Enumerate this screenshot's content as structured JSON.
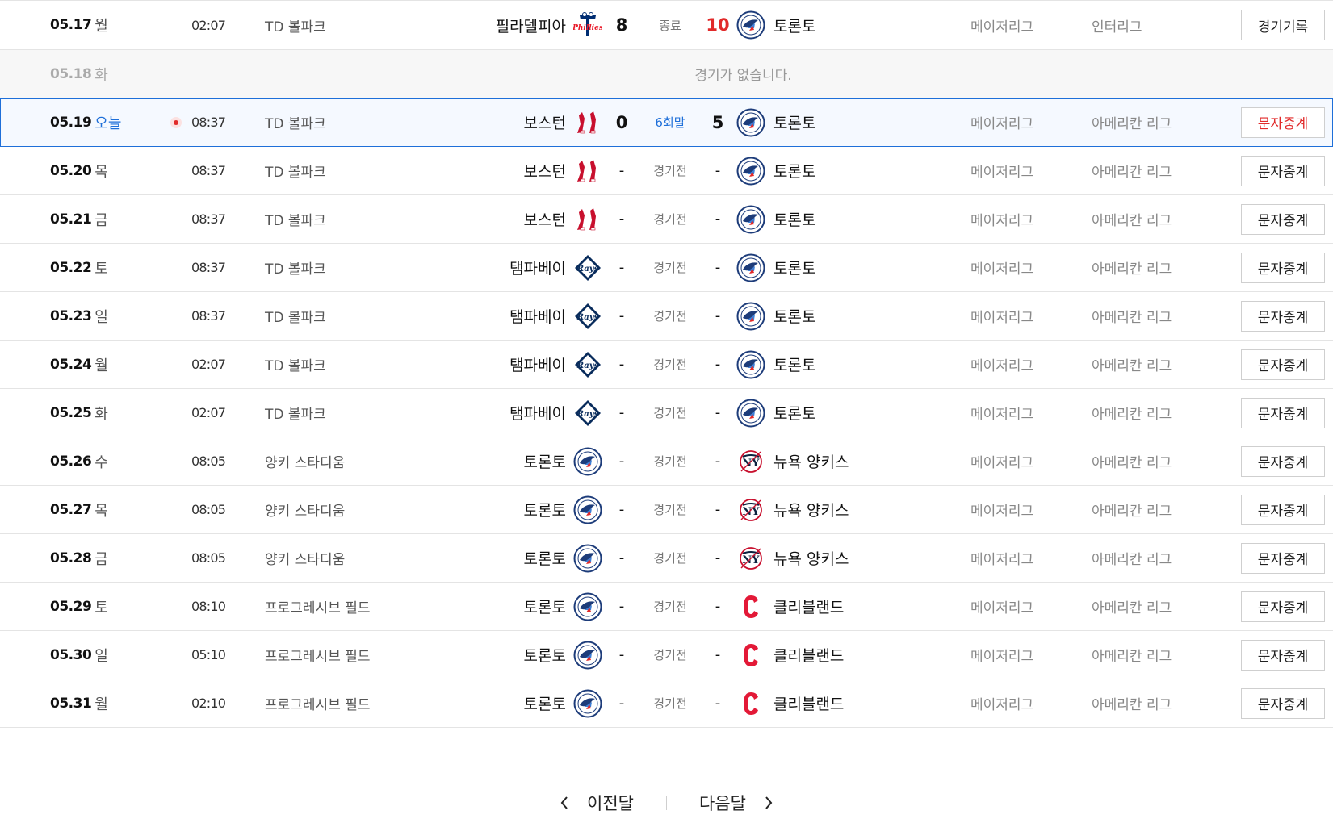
{
  "rows": [
    {
      "date": "05.17",
      "dow": "월",
      "time": "02:07",
      "stadium": "TD 볼파크",
      "away": "필라델피아",
      "away_logo": "phillies-logo",
      "away_score": "8",
      "status": "종료",
      "home_score": "10",
      "home": "토론토",
      "home_logo": "bluejays-logo",
      "league": "메이저리그",
      "division": "인터리그",
      "button": "경기기록",
      "type": "final",
      "winner": "home"
    },
    {
      "date": "05.18",
      "dow": "화",
      "type": "empty",
      "empty_text": "경기가 없습니다."
    },
    {
      "date": "05.19",
      "dow": "오늘",
      "time": "08:37",
      "stadium": "TD 볼파크",
      "away": "보스턴",
      "away_logo": "redsox-logo",
      "away_score": "0",
      "status": "6회말",
      "home_score": "5",
      "home": "토론토",
      "home_logo": "bluejays-logo",
      "league": "메이저리그",
      "division": "아메리칸 리그",
      "button": "문자중계",
      "type": "live"
    },
    {
      "date": "05.20",
      "dow": "목",
      "time": "08:37",
      "stadium": "TD 볼파크",
      "away": "보스턴",
      "away_logo": "redsox-logo",
      "away_score": "-",
      "status": "경기전",
      "home_score": "-",
      "home": "토론토",
      "home_logo": "bluejays-logo",
      "league": "메이저리그",
      "division": "아메리칸 리그",
      "button": "문자중계",
      "type": "scheduled"
    },
    {
      "date": "05.21",
      "dow": "금",
      "time": "08:37",
      "stadium": "TD 볼파크",
      "away": "보스턴",
      "away_logo": "redsox-logo",
      "away_score": "-",
      "status": "경기전",
      "home_score": "-",
      "home": "토론토",
      "home_logo": "bluejays-logo",
      "league": "메이저리그",
      "division": "아메리칸 리그",
      "button": "문자중계",
      "type": "scheduled"
    },
    {
      "date": "05.22",
      "dow": "토",
      "time": "08:37",
      "stadium": "TD 볼파크",
      "away": "탬파베이",
      "away_logo": "rays-logo",
      "away_score": "-",
      "status": "경기전",
      "home_score": "-",
      "home": "토론토",
      "home_logo": "bluejays-logo",
      "league": "메이저리그",
      "division": "아메리칸 리그",
      "button": "문자중계",
      "type": "scheduled"
    },
    {
      "date": "05.23",
      "dow": "일",
      "time": "08:37",
      "stadium": "TD 볼파크",
      "away": "탬파베이",
      "away_logo": "rays-logo",
      "away_score": "-",
      "status": "경기전",
      "home_score": "-",
      "home": "토론토",
      "home_logo": "bluejays-logo",
      "league": "메이저리그",
      "division": "아메리칸 리그",
      "button": "문자중계",
      "type": "scheduled"
    },
    {
      "date": "05.24",
      "dow": "월",
      "time": "02:07",
      "stadium": "TD 볼파크",
      "away": "탬파베이",
      "away_logo": "rays-logo",
      "away_score": "-",
      "status": "경기전",
      "home_score": "-",
      "home": "토론토",
      "home_logo": "bluejays-logo",
      "league": "메이저리그",
      "division": "아메리칸 리그",
      "button": "문자중계",
      "type": "scheduled"
    },
    {
      "date": "05.25",
      "dow": "화",
      "time": "02:07",
      "stadium": "TD 볼파크",
      "away": "탬파베이",
      "away_logo": "rays-logo",
      "away_score": "-",
      "status": "경기전",
      "home_score": "-",
      "home": "토론토",
      "home_logo": "bluejays-logo",
      "league": "메이저리그",
      "division": "아메리칸 리그",
      "button": "문자중계",
      "type": "scheduled"
    },
    {
      "date": "05.26",
      "dow": "수",
      "time": "08:05",
      "stadium": "양키 스타디움",
      "away": "토론토",
      "away_logo": "bluejays-logo",
      "away_score": "-",
      "status": "경기전",
      "home_score": "-",
      "home": "뉴욕 양키스",
      "home_logo": "yankees-logo",
      "league": "메이저리그",
      "division": "아메리칸 리그",
      "button": "문자중계",
      "type": "scheduled"
    },
    {
      "date": "05.27",
      "dow": "목",
      "time": "08:05",
      "stadium": "양키 스타디움",
      "away": "토론토",
      "away_logo": "bluejays-logo",
      "away_score": "-",
      "status": "경기전",
      "home_score": "-",
      "home": "뉴욕 양키스",
      "home_logo": "yankees-logo",
      "league": "메이저리그",
      "division": "아메리칸 리그",
      "button": "문자중계",
      "type": "scheduled"
    },
    {
      "date": "05.28",
      "dow": "금",
      "time": "08:05",
      "stadium": "양키 스타디움",
      "away": "토론토",
      "away_logo": "bluejays-logo",
      "away_score": "-",
      "status": "경기전",
      "home_score": "-",
      "home": "뉴욕 양키스",
      "home_logo": "yankees-logo",
      "league": "메이저리그",
      "division": "아메리칸 리그",
      "button": "문자중계",
      "type": "scheduled"
    },
    {
      "date": "05.29",
      "dow": "토",
      "time": "08:10",
      "stadium": "프로그레시브 필드",
      "away": "토론토",
      "away_logo": "bluejays-logo",
      "away_score": "-",
      "status": "경기전",
      "home_score": "-",
      "home": "클리블랜드",
      "home_logo": "guardians-logo",
      "league": "메이저리그",
      "division": "아메리칸 리그",
      "button": "문자중계",
      "type": "scheduled"
    },
    {
      "date": "05.30",
      "dow": "일",
      "time": "05:10",
      "stadium": "프로그레시브 필드",
      "away": "토론토",
      "away_logo": "bluejays-logo",
      "away_score": "-",
      "status": "경기전",
      "home_score": "-",
      "home": "클리블랜드",
      "home_logo": "guardians-logo",
      "league": "메이저리그",
      "division": "아메리칸 리그",
      "button": "문자중계",
      "type": "scheduled"
    },
    {
      "date": "05.31",
      "dow": "월",
      "time": "02:10",
      "stadium": "프로그레시브 필드",
      "away": "토론토",
      "away_logo": "bluejays-logo",
      "away_score": "-",
      "status": "경기전",
      "home_score": "-",
      "home": "클리블랜드",
      "home_logo": "guardians-logo",
      "league": "메이저리그",
      "division": "아메리칸 리그",
      "button": "문자중계",
      "type": "scheduled"
    }
  ],
  "pager": {
    "prev_label": "이전달",
    "next_label": "다음달",
    "prev_icon": "chevron-left-icon",
    "next_icon": "chevron-right-icon"
  },
  "colors": {
    "accent_blue": "#1e6fd9",
    "live_red": "#e12a2a",
    "border": "#e4e4e4"
  }
}
